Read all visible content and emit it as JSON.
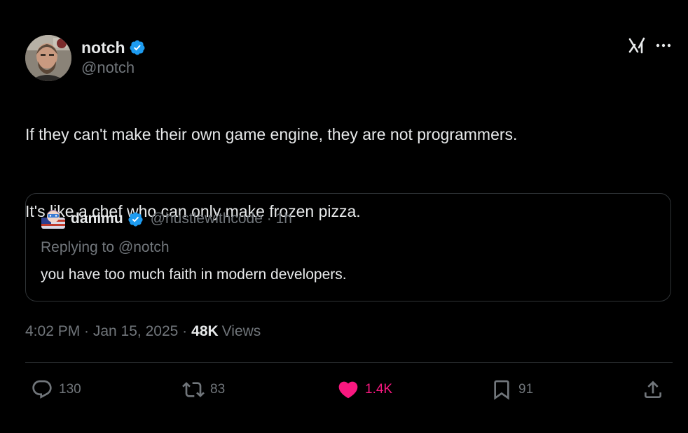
{
  "author": {
    "display_name": "notch",
    "handle": "@notch",
    "verified": true
  },
  "top_actions": {
    "grok_icon": "grok-icon",
    "more_icon": "more-icon"
  },
  "tweet": {
    "line1": "If they can't make their own game engine, they are not programmers.",
    "line2": "It's like a chef who can only make frozen pizza."
  },
  "quote": {
    "display_name": "danimu",
    "handle_time": "@hustlewithcode · 1h",
    "replying_to": "Replying to @notch",
    "text": "you have too much faith in modern developers."
  },
  "meta": {
    "time_date": "4:02 PM · Jan 15, 2025 ·",
    "views_count": "48K",
    "views_label": "Views"
  },
  "actions": {
    "replies": "130",
    "reposts": "83",
    "likes": "1.4K",
    "bookmarks": "91"
  },
  "colors": {
    "background": "#000000",
    "text": "#e7e9ea",
    "secondary": "#71767b",
    "border": "#2f3336",
    "verified": "#1d9bf0",
    "like": "#f91880"
  }
}
